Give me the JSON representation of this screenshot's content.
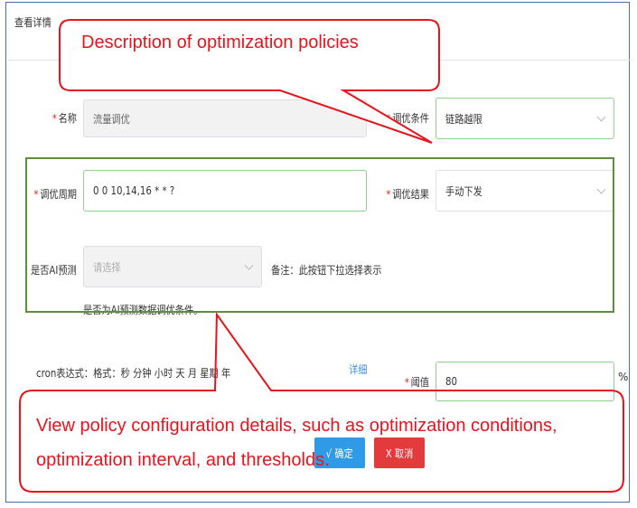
{
  "header": {
    "title": "查看详情"
  },
  "form": {
    "name": {
      "label": "名称",
      "value": "流量调优"
    },
    "condition": {
      "label": "调优条件",
      "value": "链路越限"
    },
    "period": {
      "label": "调优周期",
      "value": "0 0 10,14,16 * * ?"
    },
    "result": {
      "label": "调优结果",
      "value": "手动下发"
    },
    "ai": {
      "label": "是否AI预测",
      "placeholder": "请选择",
      "note": "备注：此按钮下拉选择表示",
      "hint": "是否为AI预测数据调优条件。"
    },
    "cron": {
      "text": "cron表达式：格式：秒 分钟 小时 天 月 星期 年",
      "link": "详细"
    },
    "threshold": {
      "label": "阈值",
      "value": "80",
      "unit": "%"
    }
  },
  "buttons": {
    "ok": "√ 确定",
    "cancel": "X 取消"
  },
  "callouts": {
    "top": "Description of optimization policies",
    "bottom": "View policy configuration details, such as optimization conditions, optimization interval, and thresholds."
  },
  "colors": {
    "callout": "#e4151b",
    "frame": "#5f8f3a",
    "ok": "#2f9be6",
    "cancel": "#e33b3b"
  }
}
